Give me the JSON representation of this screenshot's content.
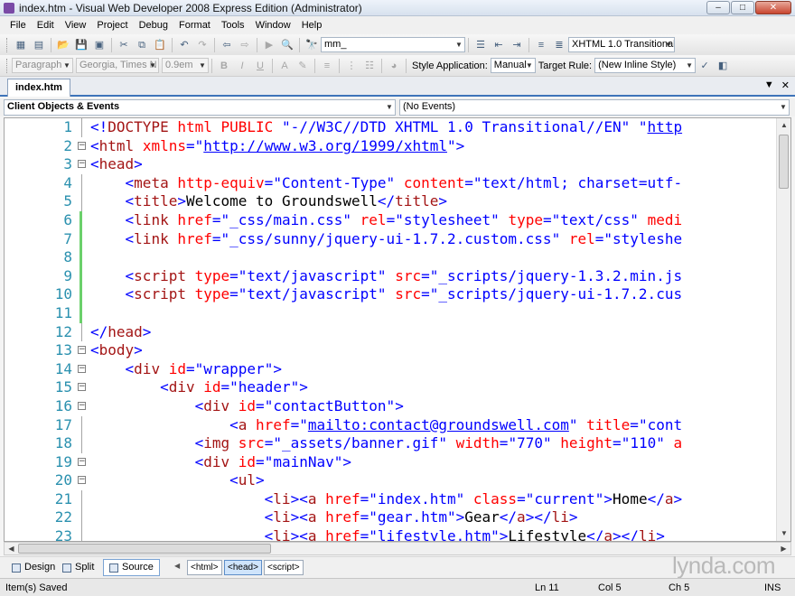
{
  "window": {
    "title": "index.htm - Visual Web Developer 2008 Express Edition (Administrator)"
  },
  "menu": [
    "File",
    "Edit",
    "View",
    "Project",
    "Debug",
    "Format",
    "Tools",
    "Window",
    "Help"
  ],
  "toolbar1": {
    "find_combo": "mm_",
    "doctype_combo": "XHTML 1.0 Transitional"
  },
  "toolbar2": {
    "block_format": "Paragraph",
    "font_family": "Georgia, Times N",
    "font_size": "0.9em",
    "style_app_label": "Style Application:",
    "style_app_value": "Manual",
    "target_rule_label": "Target Rule:",
    "target_rule_value": "(New Inline Style)"
  },
  "document_tab": {
    "label": "index.htm"
  },
  "nav_combos": {
    "objects": "Client Objects & Events",
    "events": "(No Events)"
  },
  "code": {
    "lines": [
      {
        "n": "1",
        "fold": "",
        "changed": false,
        "html": "<span class=\"b\">&lt;!</span><span class=\"t\">DOCTYPE</span> <span class=\"a\">html</span> <span class=\"a\">PUBLIC</span> <span class=\"v\">\"-//W3C//DTD XHTML 1.0 Transitional//EN\"</span> <span class=\"v\">\"</span><span class=\"u\">http</span>"
      },
      {
        "n": "2",
        "fold": "−",
        "changed": false,
        "html": "<span class=\"b\">&lt;</span><span class=\"t\">html</span> <span class=\"a\">xmlns</span><span class=\"b\">=</span><span class=\"v\">\"</span><span class=\"u\">http://www.w3.org/1999/xhtml</span><span class=\"v\">\"</span><span class=\"b\">&gt;</span>"
      },
      {
        "n": "3",
        "fold": "−",
        "changed": false,
        "html": "<span class=\"b\">&lt;</span><span class=\"t\">head</span><span class=\"b\">&gt;</span>"
      },
      {
        "n": "4",
        "fold": "",
        "changed": false,
        "html": "    <span class=\"b\">&lt;</span><span class=\"t\">meta</span> <span class=\"a\">http-equiv</span><span class=\"b\">=</span><span class=\"v\">\"Content-Type\"</span> <span class=\"a\">content</span><span class=\"b\">=</span><span class=\"v\">\"text/html; charset=utf-</span>"
      },
      {
        "n": "5",
        "fold": "",
        "changed": false,
        "html": "    <span class=\"b\">&lt;</span><span class=\"t\">title</span><span class=\"b\">&gt;</span><span class=\"k\">Welcome to Groundswell</span><span class=\"b\">&lt;/</span><span class=\"t\">title</span><span class=\"b\">&gt;</span>"
      },
      {
        "n": "6",
        "fold": "",
        "changed": true,
        "html": "    <span class=\"b\">&lt;</span><span class=\"t\">link</span> <span class=\"a\">href</span><span class=\"b\">=</span><span class=\"v\">\"_css/main.css\"</span> <span class=\"a\">rel</span><span class=\"b\">=</span><span class=\"v\">\"stylesheet\"</span> <span class=\"a\">type</span><span class=\"b\">=</span><span class=\"v\">\"text/css\"</span> <span class=\"a\">medi</span>"
      },
      {
        "n": "7",
        "fold": "",
        "changed": true,
        "html": "    <span class=\"b\">&lt;</span><span class=\"t\">link</span> <span class=\"a\">href</span><span class=\"b\">=</span><span class=\"v\">\"_css/sunny/jquery-ui-1.7.2.custom.css\"</span> <span class=\"a\">rel</span><span class=\"b\">=</span><span class=\"v\">\"styleshe</span>"
      },
      {
        "n": "8",
        "fold": "",
        "changed": true,
        "html": ""
      },
      {
        "n": "9",
        "fold": "",
        "changed": true,
        "html": "    <span class=\"b\">&lt;</span><span class=\"t\">script</span> <span class=\"a\">type</span><span class=\"b\">=</span><span class=\"v\">\"text/javascript\"</span> <span class=\"a\">src</span><span class=\"b\">=</span><span class=\"v\">\"_scripts/jquery-1.3.2.min.js</span>"
      },
      {
        "n": "10",
        "fold": "",
        "changed": true,
        "html": "    <span class=\"b\">&lt;</span><span class=\"t\">script</span> <span class=\"a\">type</span><span class=\"b\">=</span><span class=\"v\">\"text/javascript\"</span> <span class=\"a\">src</span><span class=\"b\">=</span><span class=\"v\">\"_scripts/jquery-ui-1.7.2.cus</span>"
      },
      {
        "n": "11",
        "fold": "",
        "changed": true,
        "html": ""
      },
      {
        "n": "12",
        "fold": "",
        "changed": false,
        "html": "<span class=\"b\">&lt;/</span><span class=\"t\">head</span><span class=\"b\">&gt;</span>"
      },
      {
        "n": "13",
        "fold": "−",
        "changed": false,
        "html": "<span class=\"b\">&lt;</span><span class=\"t\">body</span><span class=\"b\">&gt;</span>"
      },
      {
        "n": "14",
        "fold": "−",
        "changed": false,
        "html": "    <span class=\"b\">&lt;</span><span class=\"t\">div</span> <span class=\"a\">id</span><span class=\"b\">=</span><span class=\"v\">\"wrapper\"</span><span class=\"b\">&gt;</span>"
      },
      {
        "n": "15",
        "fold": "−",
        "changed": false,
        "html": "        <span class=\"b\">&lt;</span><span class=\"t\">div</span> <span class=\"a\">id</span><span class=\"b\">=</span><span class=\"v\">\"header\"</span><span class=\"b\">&gt;</span>"
      },
      {
        "n": "16",
        "fold": "−",
        "changed": false,
        "html": "            <span class=\"b\">&lt;</span><span class=\"t\">div</span> <span class=\"a\">id</span><span class=\"b\">=</span><span class=\"v\">\"contactButton\"</span><span class=\"b\">&gt;</span>"
      },
      {
        "n": "17",
        "fold": "",
        "changed": false,
        "html": "                <span class=\"b\">&lt;</span><span class=\"t\">a</span> <span class=\"a\">href</span><span class=\"b\">=</span><span class=\"v\">\"</span><span class=\"u\">mailto:contact@groundswell.com</span><span class=\"v\">\"</span> <span class=\"a\">title</span><span class=\"b\">=</span><span class=\"v\">\"cont</span>"
      },
      {
        "n": "18",
        "fold": "",
        "changed": false,
        "html": "            <span class=\"b\">&lt;</span><span class=\"t\">img</span> <span class=\"a\">src</span><span class=\"b\">=</span><span class=\"v\">\"_assets/banner.gif\"</span> <span class=\"a\">width</span><span class=\"b\">=</span><span class=\"v\">\"770\"</span> <span class=\"a\">height</span><span class=\"b\">=</span><span class=\"v\">\"110\"</span> <span class=\"a\">a</span>"
      },
      {
        "n": "19",
        "fold": "−",
        "changed": false,
        "html": "            <span class=\"b\">&lt;</span><span class=\"t\">div</span> <span class=\"a\">id</span><span class=\"b\">=</span><span class=\"v\">\"mainNav\"</span><span class=\"b\">&gt;</span>"
      },
      {
        "n": "20",
        "fold": "−",
        "changed": false,
        "html": "                <span class=\"b\">&lt;</span><span class=\"t\">ul</span><span class=\"b\">&gt;</span>"
      },
      {
        "n": "21",
        "fold": "",
        "changed": false,
        "html": "                    <span class=\"b\">&lt;</span><span class=\"t\">li</span><span class=\"b\">&gt;&lt;</span><span class=\"t\">a</span> <span class=\"a\">href</span><span class=\"b\">=</span><span class=\"v\">\"index.htm\"</span> <span class=\"a\">class</span><span class=\"b\">=</span><span class=\"v\">\"current\"</span><span class=\"b\">&gt;</span><span class=\"k\">Home</span><span class=\"b\">&lt;/</span><span class=\"t\">a</span><span class=\"b\">&gt;</span>"
      },
      {
        "n": "22",
        "fold": "",
        "changed": false,
        "html": "                    <span class=\"b\">&lt;</span><span class=\"t\">li</span><span class=\"b\">&gt;&lt;</span><span class=\"t\">a</span> <span class=\"a\">href</span><span class=\"b\">=</span><span class=\"v\">\"gear.htm\"</span><span class=\"b\">&gt;</span><span class=\"k\">Gear</span><span class=\"b\">&lt;/</span><span class=\"t\">a</span><span class=\"b\">&gt;&lt;/</span><span class=\"t\">li</span><span class=\"b\">&gt;</span>"
      },
      {
        "n": "23",
        "fold": "",
        "changed": false,
        "html": "                    <span class=\"b\">&lt;</span><span class=\"t\">li</span><span class=\"b\">&gt;&lt;</span><span class=\"t\">a</span> <span class=\"a\">href</span><span class=\"b\">=</span><span class=\"v\">\"lifestyle.htm\"</span><span class=\"b\">&gt;</span><span class=\"k\">Lifestyle</span><span class=\"b\">&lt;/</span><span class=\"t\">a</span><span class=\"b\">&gt;&lt;/</span><span class=\"t\">li</span><span class=\"b\">&gt;</span>"
      }
    ]
  },
  "view_tabs": {
    "design": "Design",
    "split": "Split",
    "source": "Source"
  },
  "tag_nav": [
    "<html>",
    "<head>",
    "<script>"
  ],
  "watermark": "lynda.com",
  "status": {
    "message": "Item(s) Saved",
    "line": "Ln 11",
    "col": "Col 5",
    "ch": "Ch 5",
    "mode": "INS"
  }
}
